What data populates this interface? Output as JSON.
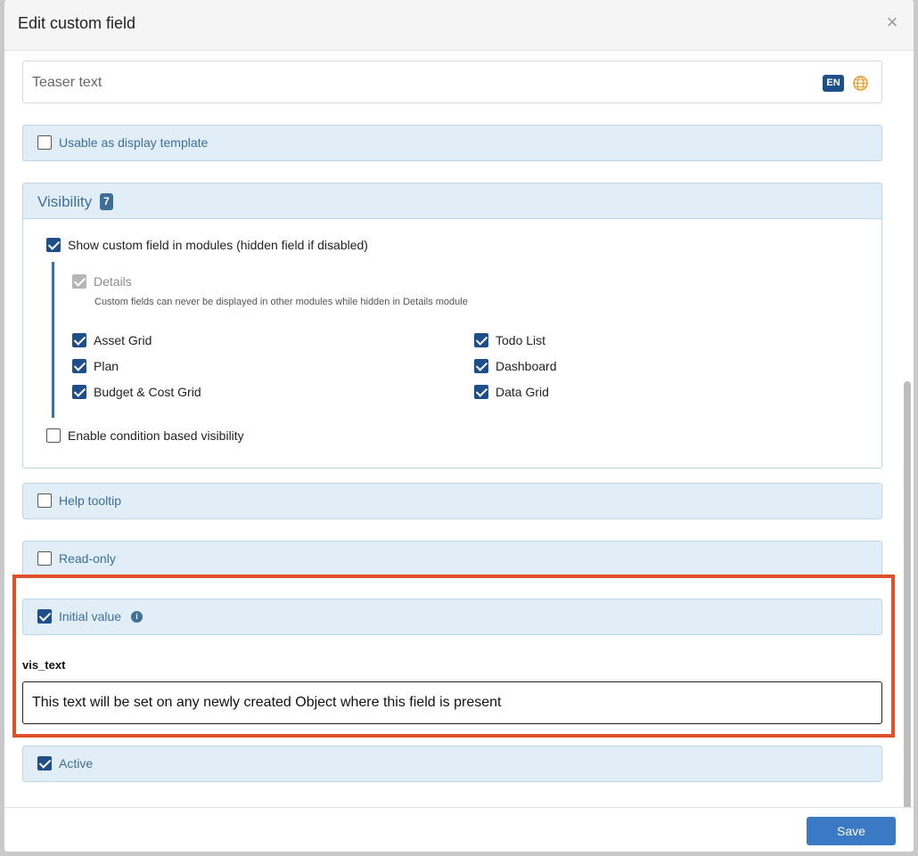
{
  "dialog": {
    "title": "Edit custom field",
    "close_glyph": "×"
  },
  "teaser": {
    "placeholder": "Teaser text",
    "lang_badge": "EN",
    "globe_icon": "globe-icon"
  },
  "display_template": {
    "label": "Usable as display template",
    "checked": false
  },
  "visibility": {
    "title": "Visibility",
    "count": "7",
    "show_in_modules": {
      "label": "Show custom field in modules (hidden field if disabled)",
      "checked": true
    },
    "details": {
      "label": "Details",
      "note": "Custom fields can never be displayed in other modules while hidden in Details module",
      "checked": true,
      "disabled": true
    },
    "modules_left": [
      {
        "label": "Asset Grid",
        "checked": true
      },
      {
        "label": "Plan",
        "checked": true
      },
      {
        "label": "Budget & Cost Grid",
        "checked": true
      }
    ],
    "modules_right": [
      {
        "label": "Todo List",
        "checked": true
      },
      {
        "label": "Dashboard",
        "checked": true
      },
      {
        "label": "Data Grid",
        "checked": true
      }
    ],
    "condition": {
      "label": "Enable condition based visibility",
      "checked": false
    }
  },
  "help_tooltip": {
    "label": "Help tooltip",
    "checked": false
  },
  "read_only": {
    "label": "Read-only",
    "checked": false
  },
  "initial_value": {
    "label": "Initial value",
    "checked": true,
    "info_glyph": "i",
    "field_label": "vis_text",
    "field_value": "This text will be set on any newly created Object where this field is present"
  },
  "active": {
    "label": "Active",
    "checked": true
  },
  "footer": {
    "save_label": "Save"
  },
  "colors": {
    "accent": "#1f4f8b",
    "panel_bg": "#e1eef8",
    "highlight": "#e0502a",
    "save_button": "#3a79c4"
  }
}
